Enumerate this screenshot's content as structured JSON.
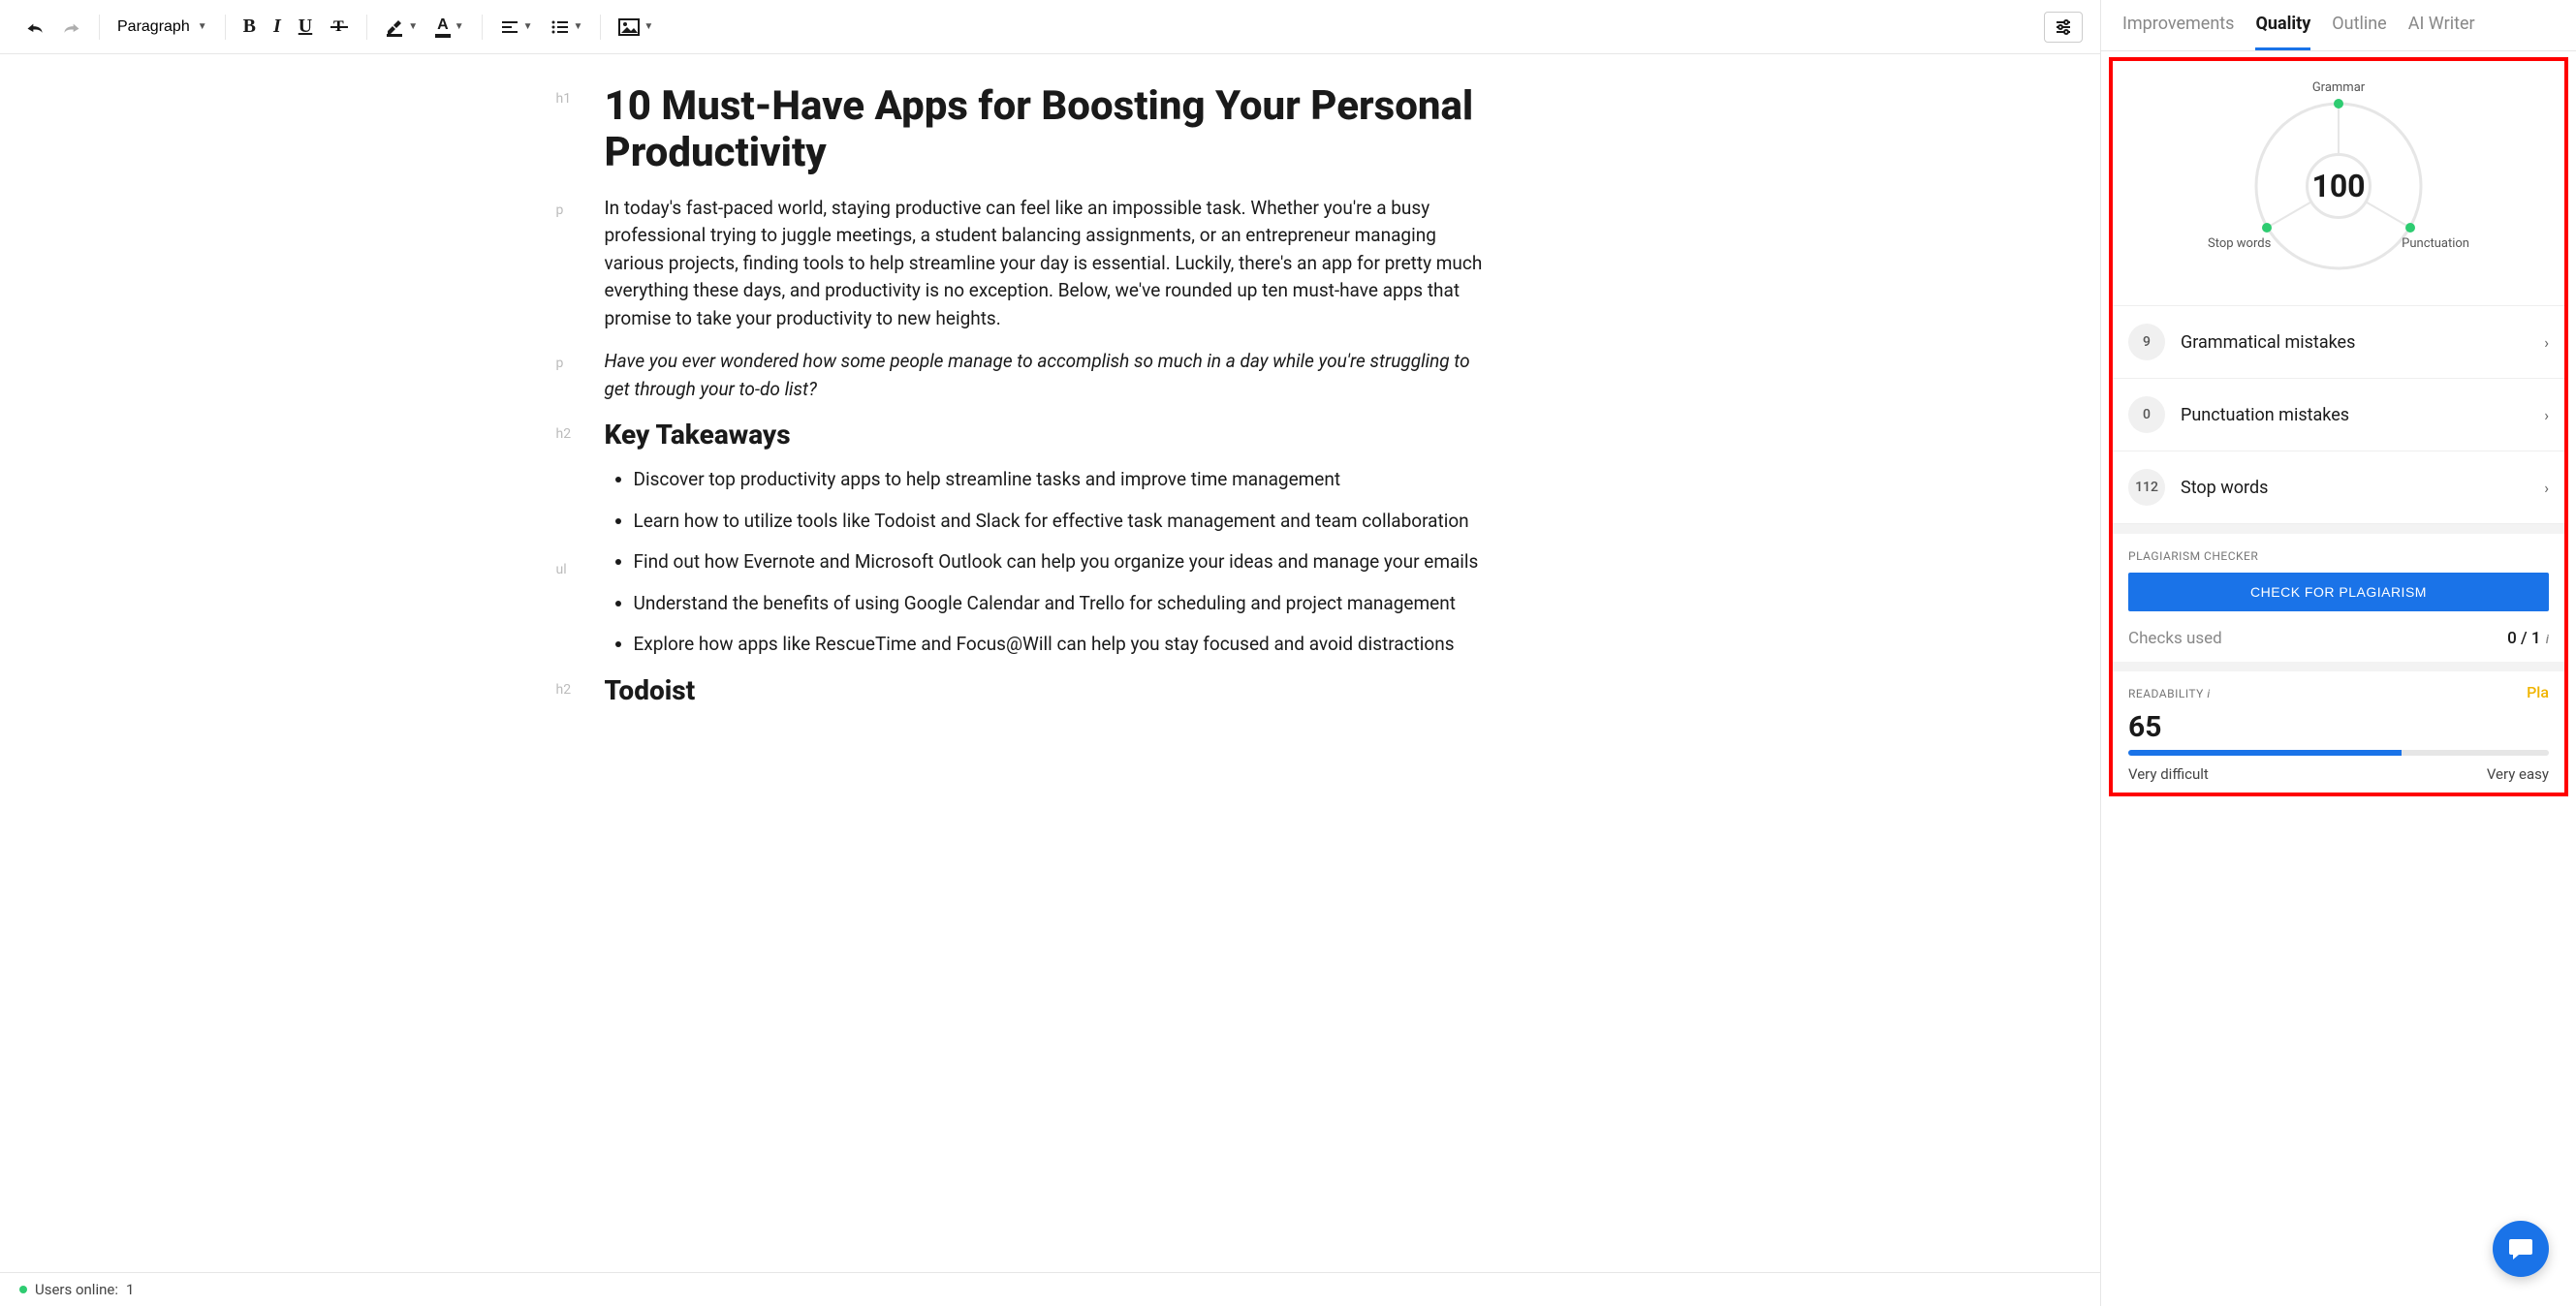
{
  "toolbar": {
    "paragraph_label": "Paragraph",
    "bold_glyph": "B",
    "italic_glyph": "I",
    "underline_glyph": "U",
    "font_color_glyph": "A"
  },
  "content": {
    "h1": "10 Must-Have Apps for Boosting Your Personal Productivity",
    "p1": "In today's fast-paced world, staying productive can feel like an impossible task. Whether you're a busy professional trying to juggle meetings, a student balancing assignments, or an entrepreneur managing various projects, finding tools to help streamline your day is essential. Luckily, there's an app for pretty much everything these days, and productivity is no exception. Below, we've rounded up ten must-have apps that promise to take your productivity to new heights.",
    "p2": "Have you ever wondered how some people manage to accomplish so much in a day while you're struggling to get through your to-do list?",
    "h2a": "Key Takeaways",
    "ul": [
      "Discover top productivity apps to help streamline tasks and improve time management",
      "Learn how to utilize tools like Todoist and Slack for effective task management and team collaboration",
      "Find out how Evernote and Microsoft Outlook can help you organize your ideas and manage your emails",
      "Understand the benefits of using Google Calendar and Trello for scheduling and project management",
      "Explore how apps like RescueTime and Focus@Will can help you stay focused and avoid distractions"
    ],
    "h2b": "Todoist",
    "tags": {
      "h1": "h1",
      "p": "p",
      "h2": "h2",
      "ul": "ul"
    }
  },
  "status": {
    "users_online_label": "Users online:",
    "users_online_count": "1"
  },
  "tabs": {
    "improvements": "Improvements",
    "quality": "Quality",
    "outline": "Outline",
    "ai_writer": "AI Writer"
  },
  "quality": {
    "score": "100",
    "labels": {
      "grammar": "Grammar",
      "stop_words": "Stop words",
      "punctuation": "Punctuation"
    },
    "issues": [
      {
        "count": "9",
        "label": "Grammatical mistakes"
      },
      {
        "count": "0",
        "label": "Punctuation mistakes"
      },
      {
        "count": "112",
        "label": "Stop words"
      }
    ],
    "plagiarism_header": "PLAGIARISM CHECKER",
    "plagiarism_button": "CHECK FOR PLAGIARISM",
    "checks_used_label": "Checks used",
    "checks_used_value": "0 / 1",
    "readability_header": "READABILITY",
    "readability_score": "65",
    "readability_fill_percent": 65,
    "readability_left": "Very difficult",
    "readability_right": "Very easy",
    "pla_hint": "Pla"
  }
}
